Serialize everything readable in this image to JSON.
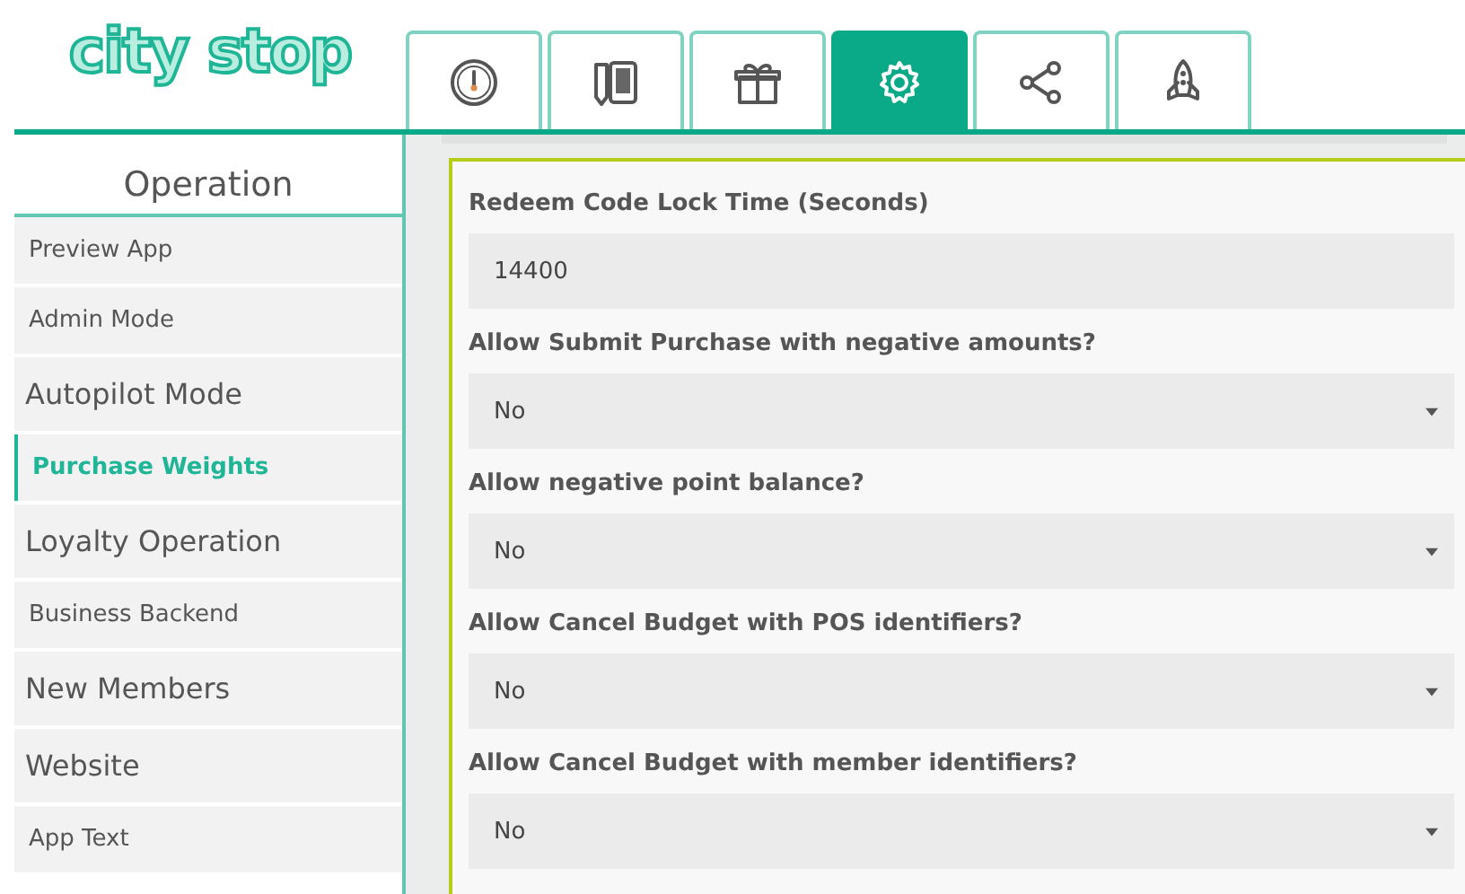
{
  "logo": {
    "text": "city stop"
  },
  "tabs": [
    {
      "kind": "gauge",
      "selected": false
    },
    {
      "kind": "devices",
      "selected": false
    },
    {
      "kind": "gift",
      "selected": false
    },
    {
      "kind": "gear",
      "selected": true
    },
    {
      "kind": "share",
      "selected": false
    },
    {
      "kind": "rocket",
      "selected": false
    }
  ],
  "sidebar": {
    "title": "Operation",
    "items": [
      {
        "label": "Preview App",
        "kind": "compact",
        "selected": false
      },
      {
        "label": "Admin Mode",
        "kind": "compact",
        "selected": false
      },
      {
        "label": "Autopilot Mode",
        "kind": "plain",
        "selected": false
      },
      {
        "label": "Purchase Weights",
        "kind": "compact",
        "selected": true
      },
      {
        "label": "Loyalty Operation",
        "kind": "plain",
        "selected": false
      },
      {
        "label": "Business Backend",
        "kind": "compact",
        "selected": false
      },
      {
        "label": "New Members",
        "kind": "plain",
        "selected": false
      },
      {
        "label": "Website",
        "kind": "plain",
        "selected": false
      },
      {
        "label": "App Text",
        "kind": "compact",
        "selected": false
      }
    ]
  },
  "form": {
    "fields": [
      {
        "label": "Redeem Code Lock Time (Seconds)",
        "kind": "text",
        "value": "14400"
      },
      {
        "label": "Allow Submit Purchase with negative amounts?",
        "kind": "select",
        "value": "No"
      },
      {
        "label": "Allow negative point balance?",
        "kind": "select",
        "value": "No"
      },
      {
        "label": "Allow Cancel Budget with POS identifiers?",
        "kind": "select",
        "value": "No"
      },
      {
        "label": "Allow Cancel Budget with member identifiers?",
        "kind": "select",
        "value": "No"
      }
    ]
  }
}
